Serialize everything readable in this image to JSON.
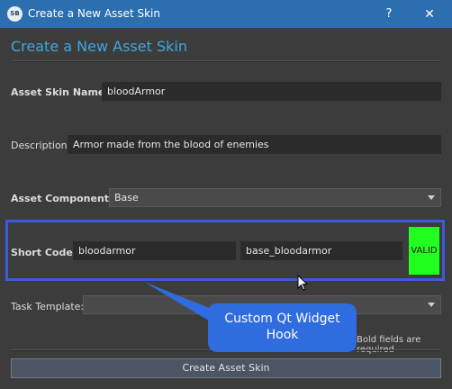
{
  "window": {
    "app_icon_text": "SB",
    "title": "Create a New Asset Skin",
    "help_label": "?",
    "close_label": "✕"
  },
  "heading": "Create a New Asset Skin",
  "form": {
    "name_label": "Asset Skin Name:",
    "name_value": "bloodArmor",
    "description_label": "Description:",
    "description_value": "Armor made from the blood of enemies",
    "component_label": "Asset Component:",
    "component_value": "Base",
    "short_code_label": "Short Code:",
    "short_code_value": "bloodarmor",
    "short_code_full": "base_bloodarmor",
    "valid_label": "VALID",
    "task_template_label": "Task Template:",
    "task_template_value": "",
    "required_note": "Bold fields are required"
  },
  "callout": {
    "line1": "Custom Qt Widget",
    "line2": "Hook"
  },
  "create_button": "Create Asset Skin",
  "colors": {
    "titlebar": "#2c6fb0",
    "heading": "#3ea7e0",
    "highlight_border": "#3b5bdb",
    "valid": "#20ff20",
    "callout": "#2f6ce0"
  }
}
